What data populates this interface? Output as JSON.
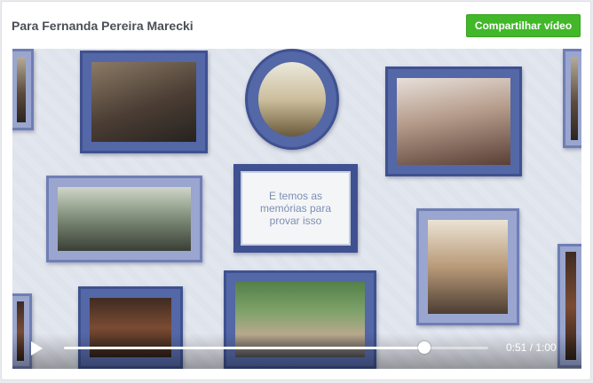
{
  "header": {
    "title": "Para Fernanda Pereira Marecki",
    "share_label": "Compartilhar vídeo"
  },
  "video": {
    "message": "E temos as memórias para provar isso",
    "progress_fraction": 0.85,
    "time_label": "0:51 / 1:00"
  },
  "icons": {
    "play": "play-icon"
  },
  "colors": {
    "share_button": "#42b72a",
    "frame_blue": "#5467a6"
  }
}
